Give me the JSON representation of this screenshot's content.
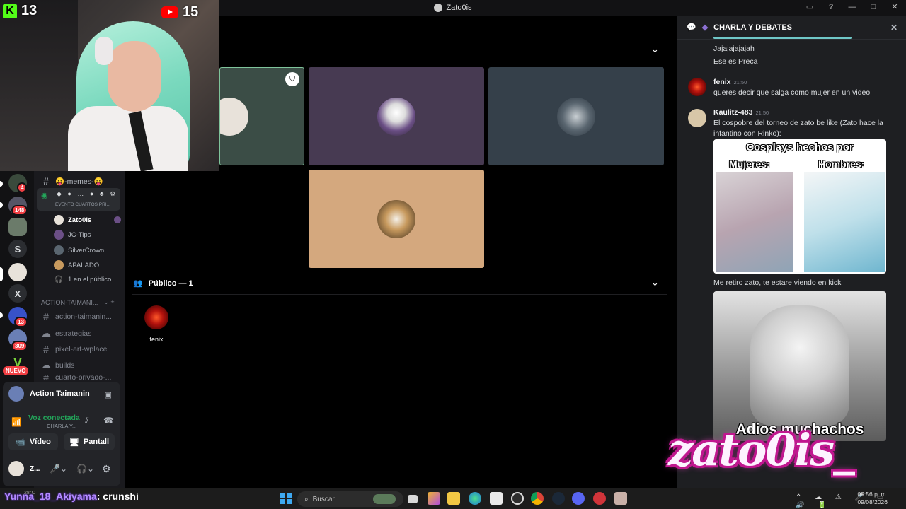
{
  "window": {
    "title": "Zato0is"
  },
  "webcam": {
    "kick_count": "13",
    "youtube_count": "15"
  },
  "servers": [
    {
      "name": "server-1",
      "badge": "4"
    },
    {
      "name": "server-2",
      "badge": "148"
    },
    {
      "name": "server-3",
      "badge": ""
    },
    {
      "name": "S",
      "badge": ""
    },
    {
      "name": "server-5",
      "badge": ""
    },
    {
      "name": "X",
      "badge": ""
    },
    {
      "name": "server-7",
      "badge": "13"
    },
    {
      "name": "server-8",
      "badge": "309"
    },
    {
      "name": "V",
      "badge": ""
    }
  ],
  "rail_new_label": "NUEVO",
  "channels": {
    "memes": "😛-memes-😛",
    "event_label": "EVENTO CUARTOS PRI...",
    "stage_users": [
      {
        "name": "Zato0is"
      },
      {
        "name": "JC-Tips"
      },
      {
        "name": "SilverCrown"
      },
      {
        "name": "APALADO"
      }
    ],
    "audience": "1 en el público",
    "category": "ACTION-TAIMANI...",
    "text_channels": [
      "action-taimanin...",
      "estrategias",
      "pixel-art-wplace",
      "builds",
      "cuarto-privado-..."
    ]
  },
  "user_panel": {
    "server_name": "Action Taimanin",
    "voice_status": "Voz conectada",
    "voice_channel": "CHARLA Y...",
    "video_label": "Vídeo",
    "screen_label": "Pantall",
    "username": "Z..."
  },
  "stage": {
    "audience_header": "Público — 1",
    "audience_member": "fenix"
  },
  "chat": {
    "header": "CHARLA Y DEBATES",
    "messages": [
      {
        "text": "Jajajajajajah"
      },
      {
        "text": "Ese es Preca"
      },
      {
        "author": "fenix",
        "time": "21:50",
        "text": "queres decir que salga como mujer en un video"
      },
      {
        "author": "Kaulitz-483",
        "time": "21:50",
        "text": "El cospobre del torneo de zato be like (Zato hace la infantino con Rinko):"
      },
      {
        "text": "Me retiro zato, te estare viendo en kick"
      }
    ],
    "meme1": {
      "title": "Cosplays hechos por",
      "left": "Mujeres:",
      "right": "Hombres:"
    },
    "meme2": {
      "caption": "Adios muchachos"
    }
  },
  "overlay": {
    "watermark": "zato0is_"
  },
  "taskbar": {
    "ticker_user": "Yunna_18_Akiyama",
    "ticker_text": ": crunshi",
    "weather": "28°C",
    "search_placeholder": "Buscar",
    "time": "09:56 p. m.",
    "date": "09/08/2026"
  },
  "colors": {
    "tile_active": "#3b4d46",
    "tile_purple": "#473a52",
    "tile_slate": "#35404a",
    "tile_tan": "#d4a87e",
    "voice_green": "#23a55a"
  }
}
